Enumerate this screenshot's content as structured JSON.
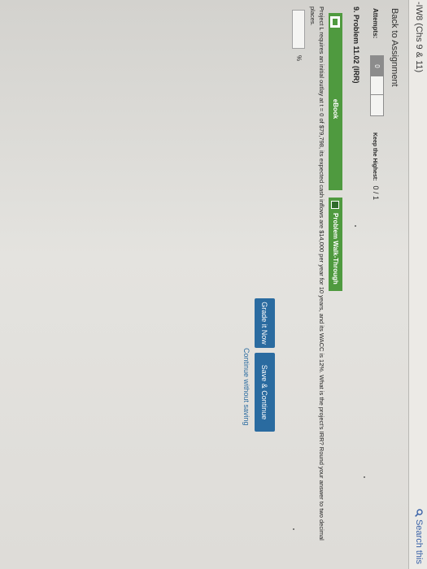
{
  "header": {
    "course_title": "-IW8 (Chs 9 & 11)",
    "search_label": "Search this"
  },
  "nav": {
    "back_label": "Back to Assignment"
  },
  "attempts": {
    "label": "Attempts:",
    "value": "0",
    "keep_label": "Keep the Highest:",
    "score": "0 / 1"
  },
  "problem": {
    "title": "9. Problem 11.02 (IRR)",
    "prompt": "Project L requires an initial outlay at t = 0 of $79,798, its expected cash inflows are $14,000 per year for 10 years, and its WACC is 12%. What is the project's IRR? Round your answer to two decimal places.",
    "answer_value": "",
    "unit": "%"
  },
  "resources": {
    "ebook_label": "eBook",
    "walkthrough_label": "Problem Walk-Through",
    "ebook_icon": "book-icon",
    "walkthrough_icon": "video-icon",
    "accent": "#4f9a3f"
  },
  "actions": {
    "grade_label": "Grade it Now",
    "save_label": "Save & Continue",
    "continue_label": "Continue without saving",
    "button_color": "#2a6ba0"
  }
}
